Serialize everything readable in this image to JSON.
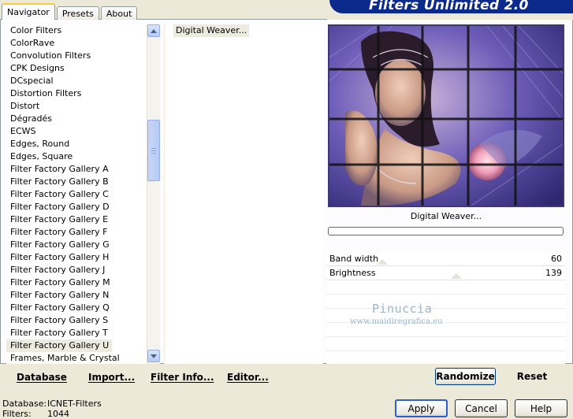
{
  "tabs": [
    {
      "label": "Navigator",
      "active": true
    },
    {
      "label": "Presets",
      "active": false
    },
    {
      "label": "About",
      "active": false
    }
  ],
  "banner": {
    "title": "Filters Unlimited 2.0"
  },
  "categories": [
    "Color Filters",
    "ColorRave",
    "Convolution Filters",
    "CPK Designs",
    "DCspecial",
    "Distortion Filters",
    "Distort",
    "Dégradés",
    "ECWS",
    "Edges, Round",
    "Edges, Square",
    "Filter Factory Gallery A",
    "Filter Factory Gallery B",
    "Filter Factory Gallery C",
    "Filter Factory Gallery D",
    "Filter Factory Gallery E",
    "Filter Factory Gallery F",
    "Filter Factory Gallery G",
    "Filter Factory Gallery H",
    "Filter Factory Gallery J",
    "Filter Factory Gallery M",
    "Filter Factory Gallery N",
    "Filter Factory Gallery Q",
    "Filter Factory Gallery S",
    "Filter Factory Gallery T",
    "Filter Factory Gallery U",
    "Frames, Marble & Crystal"
  ],
  "selected_category": "Filter Factory Gallery U",
  "filters": [
    "Digital Weaver..."
  ],
  "preview": {
    "filter_name": "Digital Weaver..."
  },
  "params": [
    {
      "label": "Band width",
      "value": "60",
      "fraction": 0.235
    },
    {
      "label": "Brightness",
      "value": "139",
      "fraction": 0.545
    }
  ],
  "watermark": {
    "line1": "Pinuccia",
    "line2": "www.maidiregrafica.eu"
  },
  "buttons": {
    "database": "Database",
    "import": "Import...",
    "filter_info": "Filter Info...",
    "editor": "Editor...",
    "randomize": "Randomize",
    "reset": "Reset",
    "apply": "Apply",
    "cancel": "Cancel",
    "help": "Help"
  },
  "status": {
    "database_label": "Database:",
    "database_value": "ICNET-Filters",
    "filters_label": "Filters:",
    "filters_value": "1044"
  }
}
